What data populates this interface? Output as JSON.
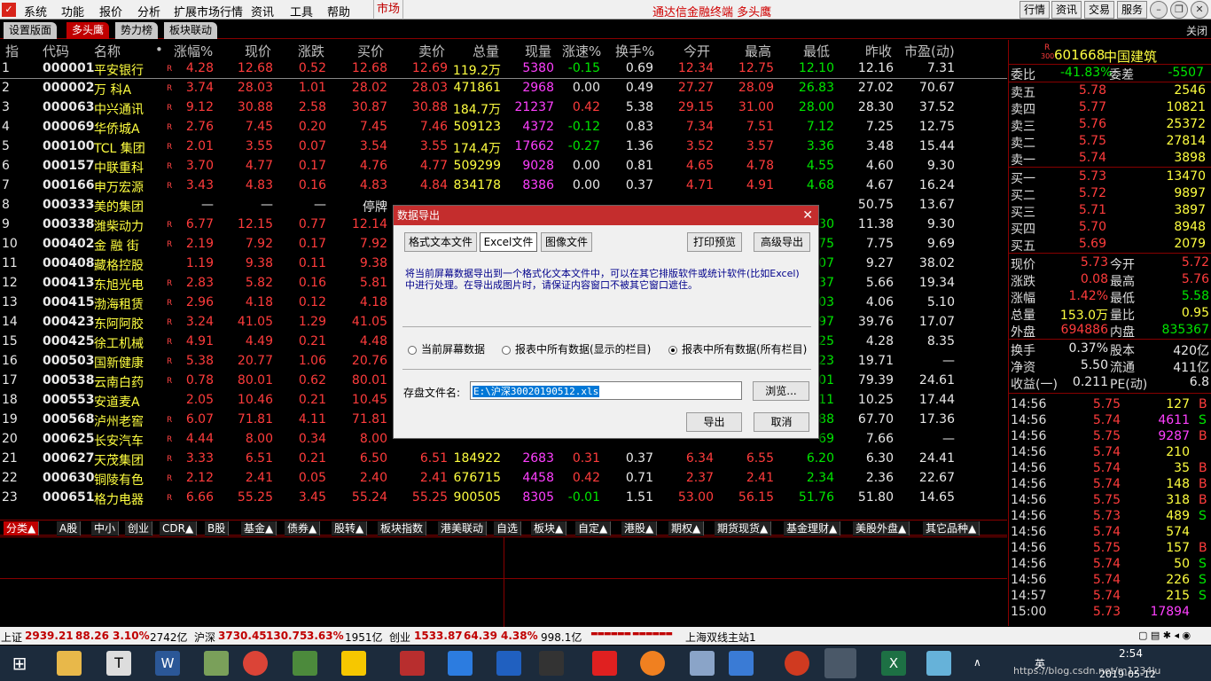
{
  "menubar": {
    "items": [
      "系统",
      "功能",
      "报价",
      "分析",
      "扩展市场行情",
      "资讯",
      "工具",
      "帮助"
    ],
    "market": "市场",
    "title": "通达信金融终端 多头鹰",
    "right_buttons": [
      "行情",
      "资讯",
      "交易",
      "服务"
    ]
  },
  "tabs": [
    "设置版面",
    "多头鹰",
    "势力榜",
    "板块联动"
  ],
  "tabs_close": "关闭",
  "columns": [
    "指",
    "代码",
    "名称",
    "•",
    "涨幅%",
    "现价",
    "涨跌",
    "买价",
    "卖价",
    "总量",
    "现量",
    "涨速%",
    "换手%",
    "今开",
    "最高",
    "最低",
    "昨收",
    "市盈(动)"
  ],
  "rows": [
    {
      "i": "1",
      "code": "000001",
      "name": "平安银行",
      "chg": "4.28",
      "price": "12.68",
      "diff": "0.52",
      "bid": "12.68",
      "ask": "12.69",
      "vol": "119.2万",
      "cur": "5380",
      "spd": "-0.15",
      "turn": "0.69",
      "open": "12.34",
      "high": "12.75",
      "low": "12.10",
      "prev": "12.16",
      "pe": "7.31"
    },
    {
      "i": "2",
      "code": "000002",
      "name": "万 科A",
      "chg": "3.74",
      "price": "28.03",
      "diff": "1.01",
      "bid": "28.02",
      "ask": "28.03",
      "vol": "471861",
      "cur": "2968",
      "spd": "0.00",
      "turn": "0.49",
      "open": "27.27",
      "high": "28.09",
      "low": "26.83",
      "prev": "27.02",
      "pe": "70.67"
    },
    {
      "i": "3",
      "code": "000063",
      "name": "中兴通讯",
      "chg": "9.12",
      "price": "30.88",
      "diff": "2.58",
      "bid": "30.87",
      "ask": "30.88",
      "vol": "184.7万",
      "cur": "21237",
      "spd": "0.42",
      "turn": "5.38",
      "open": "29.15",
      "high": "31.00",
      "low": "28.00",
      "prev": "28.30",
      "pe": "37.52"
    },
    {
      "i": "4",
      "code": "000069",
      "name": "华侨城A",
      "chg": "2.76",
      "price": "7.45",
      "diff": "0.20",
      "bid": "7.45",
      "ask": "7.46",
      "vol": "509123",
      "cur": "4372",
      "spd": "-0.12",
      "turn": "0.83",
      "open": "7.34",
      "high": "7.51",
      "low": "7.12",
      "prev": "7.25",
      "pe": "12.75"
    },
    {
      "i": "5",
      "code": "000100",
      "name": "TCL 集团",
      "chg": "2.01",
      "price": "3.55",
      "diff": "0.07",
      "bid": "3.54",
      "ask": "3.55",
      "vol": "174.4万",
      "cur": "17662",
      "spd": "-0.27",
      "turn": "1.36",
      "open": "3.52",
      "high": "3.57",
      "low": "3.36",
      "prev": "3.48",
      "pe": "15.44"
    },
    {
      "i": "6",
      "code": "000157",
      "name": "中联重科",
      "chg": "3.70",
      "price": "4.77",
      "diff": "0.17",
      "bid": "4.76",
      "ask": "4.77",
      "vol": "509299",
      "cur": "9028",
      "spd": "0.00",
      "turn": "0.81",
      "open": "4.65",
      "high": "4.78",
      "low": "4.55",
      "prev": "4.60",
      "pe": "9.30"
    },
    {
      "i": "7",
      "code": "000166",
      "name": "申万宏源",
      "chg": "3.43",
      "price": "4.83",
      "diff": "0.16",
      "bid": "4.83",
      "ask": "4.84",
      "vol": "834178",
      "cur": "8386",
      "spd": "0.00",
      "turn": "0.37",
      "open": "4.71",
      "high": "4.91",
      "low": "4.68",
      "prev": "4.67",
      "pe": "16.24"
    },
    {
      "i": "8",
      "code": "000333",
      "name": "美的集团",
      "chg": "—",
      "price": "—",
      "diff": "—",
      "bid": "停牌",
      "ask": "",
      "vol": "",
      "cur": "",
      "spd": "",
      "turn": "",
      "open": "",
      "high": "",
      "low": "",
      "prev": "50.75",
      "pe": "13.67"
    },
    {
      "i": "9",
      "code": "000338",
      "name": "潍柴动力",
      "chg": "6.77",
      "price": "12.15",
      "diff": "0.77",
      "bid": "12.14",
      "ask": "",
      "vol": "",
      "cur": "",
      "spd": "",
      "turn": "",
      "open": "",
      "high": "",
      "low": "30",
      "prev": "11.38",
      "pe": "9.30"
    },
    {
      "i": "10",
      "code": "000402",
      "name": "金 融 街",
      "chg": "2.19",
      "price": "7.92",
      "diff": "0.17",
      "bid": "7.92",
      "ask": "",
      "vol": "",
      "cur": "",
      "spd": "",
      "turn": "",
      "open": "",
      "high": "",
      "low": "75",
      "prev": "7.75",
      "pe": "9.69"
    },
    {
      "i": "11",
      "code": "000408",
      "name": "藏格控股",
      "chg": "1.19",
      "price": "9.38",
      "diff": "0.11",
      "bid": "9.38",
      "ask": "",
      "vol": "",
      "cur": "",
      "spd": "",
      "turn": "",
      "open": "",
      "high": "",
      "low": "07",
      "prev": "9.27",
      "pe": "38.02"
    },
    {
      "i": "12",
      "code": "000413",
      "name": "东旭光电",
      "chg": "2.83",
      "price": "5.82",
      "diff": "0.16",
      "bid": "5.81",
      "ask": "",
      "vol": "",
      "cur": "",
      "spd": "",
      "turn": "",
      "open": "",
      "high": "",
      "low": "37",
      "prev": "5.66",
      "pe": "19.34"
    },
    {
      "i": "13",
      "code": "000415",
      "name": "渤海租赁",
      "chg": "2.96",
      "price": "4.18",
      "diff": "0.12",
      "bid": "4.18",
      "ask": "",
      "vol": "",
      "cur": "",
      "spd": "",
      "turn": "",
      "open": "",
      "high": "",
      "low": "03",
      "prev": "4.06",
      "pe": "5.10"
    },
    {
      "i": "14",
      "code": "000423",
      "name": "东阿阿胶",
      "chg": "3.24",
      "price": "41.05",
      "diff": "1.29",
      "bid": "41.05",
      "ask": "",
      "vol": "",
      "cur": "",
      "spd": "",
      "turn": "",
      "open": "",
      "high": "",
      "low": "97",
      "prev": "39.76",
      "pe": "17.07"
    },
    {
      "i": "15",
      "code": "000425",
      "name": "徐工机械",
      "chg": "4.91",
      "price": "4.49",
      "diff": "0.21",
      "bid": "4.48",
      "ask": "",
      "vol": "",
      "cur": "",
      "spd": "",
      "turn": "",
      "open": "",
      "high": "",
      "low": "25",
      "prev": "4.28",
      "pe": "8.35"
    },
    {
      "i": "16",
      "code": "000503",
      "name": "国新健康",
      "chg": "5.38",
      "price": "20.77",
      "diff": "1.06",
      "bid": "20.76",
      "ask": "",
      "vol": "",
      "cur": "",
      "spd": "",
      "turn": "",
      "open": "",
      "high": "",
      "low": "23",
      "prev": "19.71",
      "pe": "—"
    },
    {
      "i": "17",
      "code": "000538",
      "name": "云南白药",
      "chg": "0.78",
      "price": "80.01",
      "diff": "0.62",
      "bid": "80.01",
      "ask": "",
      "vol": "",
      "cur": "",
      "spd": "",
      "turn": "",
      "open": "",
      "high": "",
      "low": "01",
      "prev": "79.39",
      "pe": "24.61"
    },
    {
      "i": "18",
      "code": "000553",
      "name": "安道麦A",
      "chg": "2.05",
      "price": "10.46",
      "diff": "0.21",
      "bid": "10.45",
      "ask": "",
      "vol": "",
      "cur": "",
      "spd": "",
      "turn": "",
      "open": "",
      "high": "",
      "low": "11",
      "prev": "10.25",
      "pe": "17.44"
    },
    {
      "i": "19",
      "code": "000568",
      "name": "泸州老窖",
      "chg": "6.07",
      "price": "71.81",
      "diff": "4.11",
      "bid": "71.81",
      "ask": "",
      "vol": "",
      "cur": "",
      "spd": "",
      "turn": "",
      "open": "",
      "high": "",
      "low": "88",
      "prev": "67.70",
      "pe": "17.36"
    },
    {
      "i": "20",
      "code": "000625",
      "name": "长安汽车",
      "chg": "4.44",
      "price": "8.00",
      "diff": "0.34",
      "bid": "8.00",
      "ask": "",
      "vol": "",
      "cur": "",
      "spd": "",
      "turn": "",
      "open": "",
      "high": "",
      "low": "69",
      "prev": "7.66",
      "pe": "—"
    },
    {
      "i": "21",
      "code": "000627",
      "name": "天茂集团",
      "chg": "3.33",
      "price": "6.51",
      "diff": "0.21",
      "bid": "6.50",
      "ask": "6.51",
      "vol": "184922",
      "cur": "2683",
      "spd": "0.31",
      "turn": "0.37",
      "open": "6.34",
      "high": "6.55",
      "low": "6.20",
      "prev": "6.30",
      "pe": "24.41"
    },
    {
      "i": "22",
      "code": "000630",
      "name": "铜陵有色",
      "chg": "2.12",
      "price": "2.41",
      "diff": "0.05",
      "bid": "2.40",
      "ask": "2.41",
      "vol": "676715",
      "cur": "4458",
      "spd": "0.42",
      "turn": "0.71",
      "open": "2.37",
      "high": "2.41",
      "low": "2.34",
      "prev": "2.36",
      "pe": "22.67"
    },
    {
      "i": "23",
      "code": "000651",
      "name": "格力电器",
      "chg": "6.66",
      "price": "55.25",
      "diff": "3.45",
      "bid": "55.24",
      "ask": "55.25",
      "vol": "900505",
      "cur": "8305",
      "spd": "-0.01",
      "turn": "1.51",
      "open": "53.00",
      "high": "56.15",
      "low": "51.76",
      "prev": "51.80",
      "pe": "14.65"
    }
  ],
  "categories": [
    "分类▲",
    "A股",
    "中小",
    "创业",
    "CDR▲",
    "B股",
    "基金▲",
    "债券▲",
    "股转▲",
    "板块指数",
    "港美联动",
    "自选",
    "板块▲",
    "自定▲",
    "港股▲",
    "期权▲",
    "期货现货▲",
    "基金理财▲",
    "美股外盘▲",
    "其它品种▲"
  ],
  "side": {
    "code": "601668",
    "name": "中国建筑",
    "badge_r": "R",
    "badge_num": "300",
    "weibi_label": "委比",
    "weibi": "-41.83%",
    "weicha_label": "委差",
    "weicha": "-5507",
    "asks": [
      {
        "label": "卖五",
        "price": "5.78",
        "vol": "2546"
      },
      {
        "label": "卖四",
        "price": "5.77",
        "vol": "10821"
      },
      {
        "label": "卖三",
        "price": "5.76",
        "vol": "25372"
      },
      {
        "label": "卖二",
        "price": "5.75",
        "vol": "27814"
      },
      {
        "label": "卖一",
        "price": "5.74",
        "vol": "3898"
      }
    ],
    "bids": [
      {
        "label": "买一",
        "price": "5.73",
        "vol": "13470"
      },
      {
        "label": "买二",
        "price": "5.72",
        "vol": "9897"
      },
      {
        "label": "买三",
        "price": "5.71",
        "vol": "3897"
      },
      {
        "label": "买四",
        "price": "5.70",
        "vol": "8948"
      },
      {
        "label": "买五",
        "price": "5.69",
        "vol": "2079"
      }
    ],
    "stats": [
      {
        "l1": "现价",
        "v1": "5.73",
        "l2": "今开",
        "v2": "5.72"
      },
      {
        "l1": "涨跌",
        "v1": "0.08",
        "l2": "最高",
        "v2": "5.76"
      },
      {
        "l1": "涨幅",
        "v1": "1.42%",
        "l2": "最低",
        "v2": "5.58"
      },
      {
        "l1": "总量",
        "v1": "153.0万",
        "l2": "量比",
        "v2": "0.95"
      },
      {
        "l1": "外盘",
        "v1": "694886",
        "l2": "内盘",
        "v2": "835367"
      }
    ],
    "stats2": [
      {
        "l1": "换手",
        "v1": "0.37%",
        "l2": "股本",
        "v2": "420亿"
      },
      {
        "l1": "净资",
        "v1": "5.50",
        "l2": "流通",
        "v2": "411亿"
      },
      {
        "l1": "收益(一)",
        "v1": "0.211",
        "l2": "PE(动)",
        "v2": "6.8"
      }
    ],
    "ticks": [
      {
        "t": "14:56",
        "p": "5.75",
        "v": "127",
        "s": "B"
      },
      {
        "t": "14:56",
        "p": "5.74",
        "v": "4611",
        "s": "S"
      },
      {
        "t": "14:56",
        "p": "5.75",
        "v": "9287",
        "s": "B"
      },
      {
        "t": "14:56",
        "p": "5.74",
        "v": "210",
        "s": ""
      },
      {
        "t": "14:56",
        "p": "5.74",
        "v": "35",
        "s": "B"
      },
      {
        "t": "14:56",
        "p": "5.74",
        "v": "148",
        "s": "B"
      },
      {
        "t": "14:56",
        "p": "5.75",
        "v": "318",
        "s": "B"
      },
      {
        "t": "14:56",
        "p": "5.73",
        "v": "489",
        "s": "S"
      },
      {
        "t": "14:56",
        "p": "5.74",
        "v": "574",
        "s": ""
      },
      {
        "t": "14:56",
        "p": "5.75",
        "v": "157",
        "s": "B"
      },
      {
        "t": "14:56",
        "p": "5.74",
        "v": "50",
        "s": "S"
      },
      {
        "t": "14:56",
        "p": "5.74",
        "v": "226",
        "s": "S"
      },
      {
        "t": "14:57",
        "p": "5.74",
        "v": "215",
        "s": "S"
      },
      {
        "t": "15:00",
        "p": "5.73",
        "v": "17894",
        "s": ""
      }
    ]
  },
  "status": {
    "sh_label": "上证",
    "sh": "2939.21",
    "sh_diff": "88.26",
    "sh_pct": "3.10%",
    "sh_amt": "2742亿",
    "sz_label": "沪深",
    "sz": "3730.45",
    "sz_diff": "130.75",
    "sz_pct": "3.63%",
    "sz_amt": "1951亿",
    "cy_label": "创业",
    "cy": "1533.87",
    "cy_diff": "64.39",
    "cy_pct": "4.38%",
    "cy_amt": "998.1亿",
    "server": "上海双线主站1"
  },
  "dialog": {
    "title": "数据导出",
    "tabs": [
      "格式文本文件",
      "Excel文件",
      "图像文件"
    ],
    "print_preview": "打印预览",
    "advanced_export": "高级导出",
    "description": "将当前屏幕数据导出到一个格式化文本文件中，可以在其它排版软件或统计软件(比如Excel)中进行处理。在导出成图片时，请保证内容窗口不被其它窗口遮住。",
    "radio": [
      "当前屏幕数据",
      "报表中所有数据(显示的栏目)",
      "报表中所有数据(所有栏目)"
    ],
    "file_label": "存盘文件名:",
    "file_value": "E:\\沪深30020190512.xls",
    "browse": "浏览...",
    "export": "导出",
    "cancel": "取消"
  },
  "taskbar": {
    "time": "2:54",
    "date": "2019-05-12",
    "ime": "英",
    "url": "https://blog.csdn.net/m1234lu"
  }
}
